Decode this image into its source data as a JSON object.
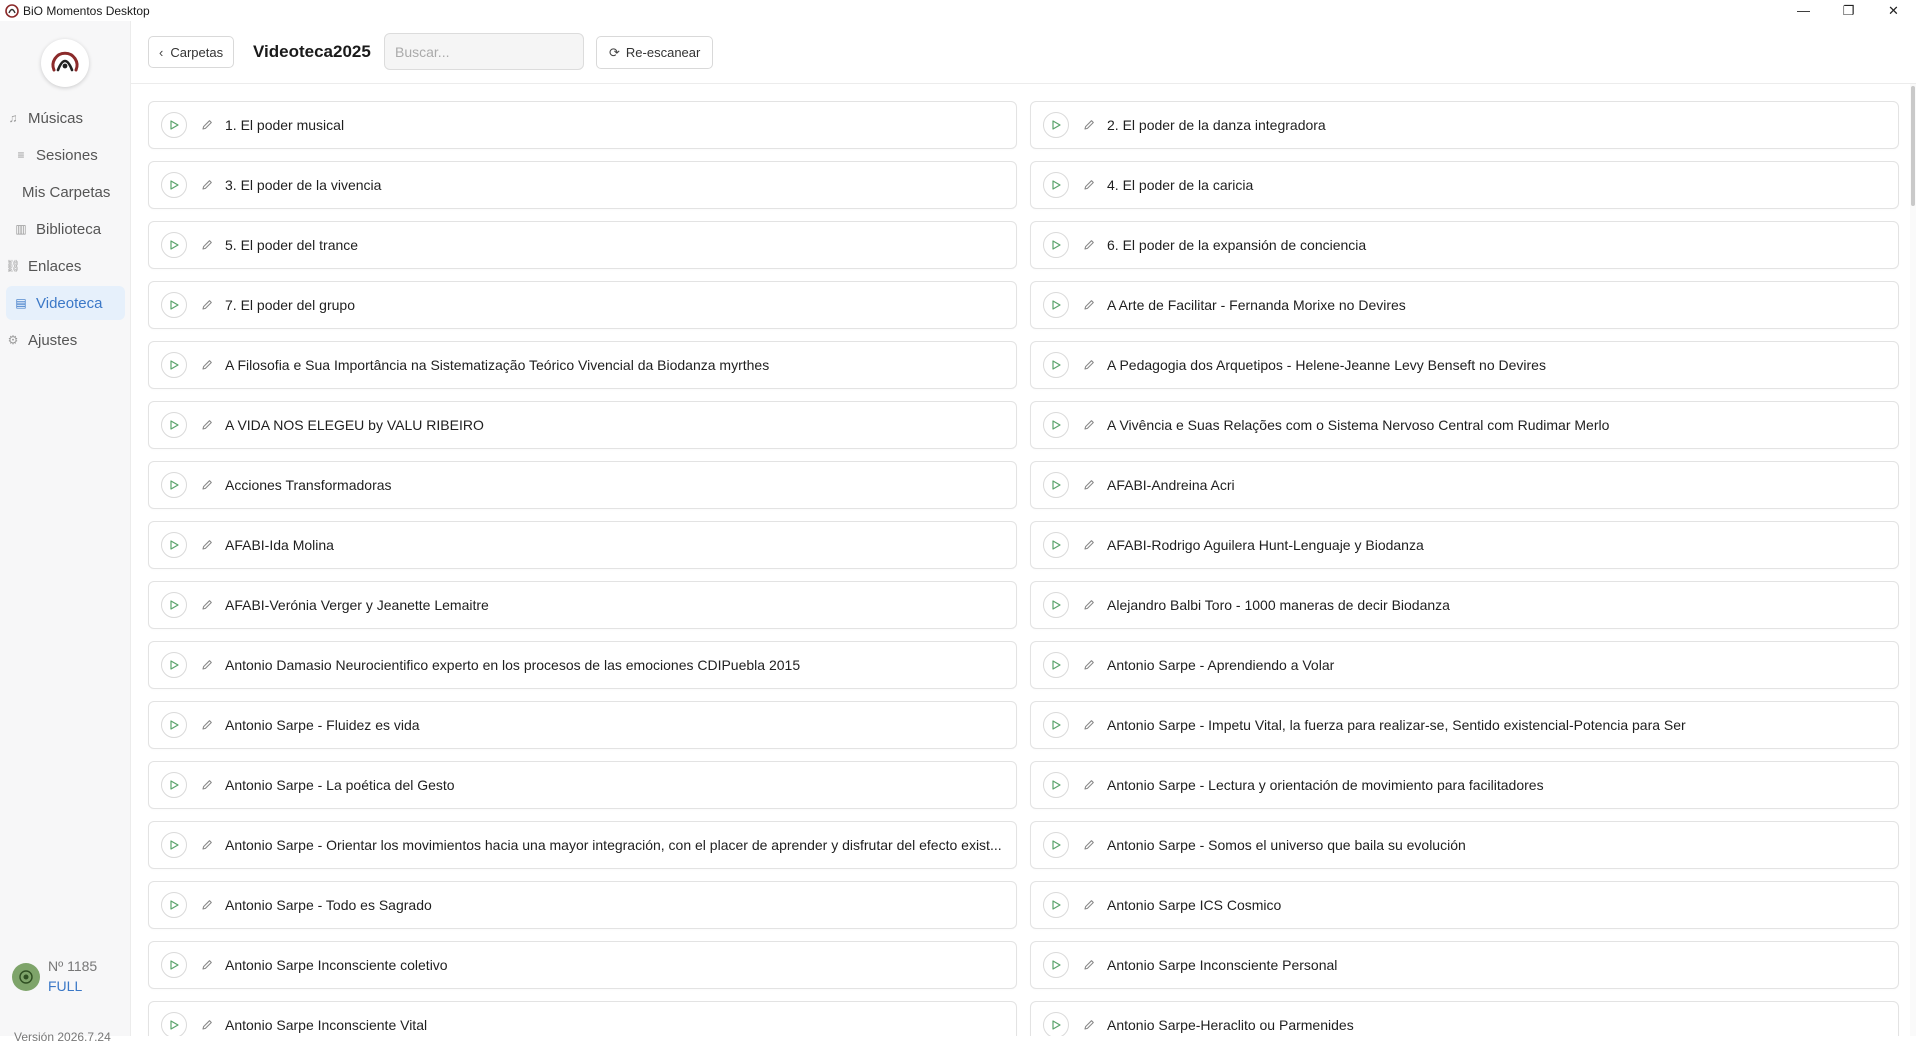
{
  "window": {
    "title": "BiO Momentos Desktop",
    "controls": {
      "minimize": "—",
      "restore": "❐",
      "close": "✕"
    }
  },
  "sidebar": {
    "items": [
      {
        "label": "Músicas",
        "icon": "music-note-icon",
        "glyph": "♫"
      },
      {
        "label": "Sesiones",
        "icon": "playlist-icon",
        "glyph": "≡"
      },
      {
        "label": "Mis Carpetas",
        "icon": "",
        "glyph": ""
      },
      {
        "label": "Biblioteca",
        "icon": "library-icon",
        "glyph": "▥"
      },
      {
        "label": "Enlaces",
        "icon": "link-icon",
        "glyph": "⛓"
      },
      {
        "label": "Videoteca",
        "icon": "video-icon",
        "glyph": "▤"
      },
      {
        "label": "Ajustes",
        "icon": "gear-icon",
        "glyph": "⚙"
      }
    ],
    "active_index": 5,
    "account": {
      "number": "Nº 1185",
      "plan": "FULL"
    },
    "version": "Versión 2026.7.24"
  },
  "header": {
    "back_label": "Carpetas",
    "title": "Videoteca2025",
    "search_placeholder": "Buscar...",
    "rescan_label": "Re-escanear"
  },
  "videos": [
    "1. El poder musical",
    "2. El poder de la danza integradora",
    "3. El poder de la vivencia",
    "4. El poder de la caricia",
    "5. El poder del trance",
    "6. El poder de la expansión de conciencia",
    "7. El poder del grupo",
    "A Arte de Facilitar - Fernanda Morixe no Devires",
    "A Filosofia e Sua Importância na Sistematização Teórico Vivencial da Biodanza myrthes",
    "A Pedagogia dos Arquetipos - Helene-Jeanne Levy Benseft no Devires",
    "A VIDA NOS ELEGEU by VALU RIBEIRO",
    "A Vivência e Suas Relações com o Sistema Nervoso Central com Rudimar Merlo",
    "Acciones Transformadoras",
    "AFABI-Andreina Acri",
    "AFABI-Ida Molina",
    "AFABI-Rodrigo Aguilera Hunt-Lenguaje y Biodanza",
    "AFABI-Verónia Verger y Jeanette Lemaitre",
    "Alejandro Balbi Toro - 1000 maneras de decir Biodanza",
    "Antonio Damasio Neurocientifico experto en los procesos de las emociones CDIPuebla 2015",
    "Antonio Sarpe - Aprendiendo a Volar",
    "Antonio Sarpe - Fluidez es vida",
    "Antonio Sarpe - Impetu Vital, la fuerza para realizar-se, Sentido existencial-Potencia para Ser",
    "Antonio Sarpe - La poética del Gesto",
    "Antonio Sarpe - Lectura y orientación de movimiento para facilitadores",
    "Antonio Sarpe - Orientar los movimientos hacia una mayor integración, con el placer de aprender y disfrutar del efecto exist...",
    "Antonio Sarpe - Somos el universo que baila su evolución",
    "Antonio Sarpe - Todo es Sagrado",
    "Antonio Sarpe ICS Cosmico",
    "Antonio Sarpe Inconsciente coletivo",
    "Antonio Sarpe Inconsciente Personal",
    "Antonio Sarpe Inconsciente Vital",
    "Antonio Sarpe-Heraclito ou Parmenides"
  ],
  "colors": {
    "accent": "#3b78c7",
    "active_bg": "#e6f0fb",
    "play_green": "#5aa36b",
    "badge_green": "#7ea46a"
  }
}
